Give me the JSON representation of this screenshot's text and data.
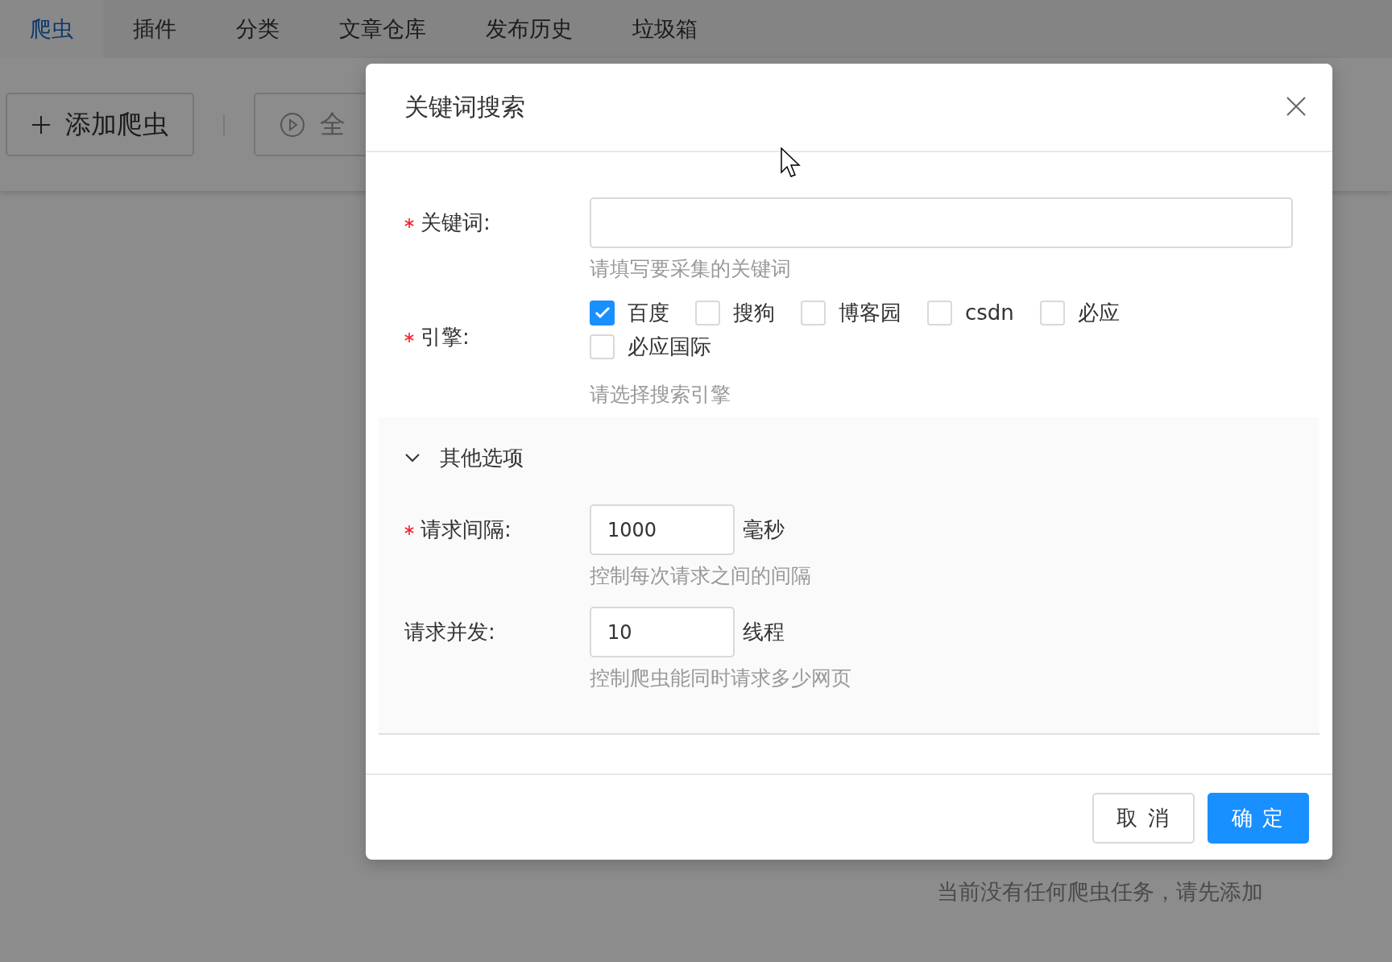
{
  "tabs": [
    {
      "label": "爬虫",
      "selected": true
    },
    {
      "label": "插件",
      "selected": false
    },
    {
      "label": "分类",
      "selected": false
    },
    {
      "label": "文章仓库",
      "selected": false
    },
    {
      "label": "发布历史",
      "selected": false
    },
    {
      "label": "垃圾箱",
      "selected": false
    }
  ],
  "toolbar": {
    "add_button": "添加爬虫",
    "run_button": "全"
  },
  "empty_state": {
    "message": "当前没有任何爬虫任务，请先添加"
  },
  "dialog": {
    "title": "关键词搜索",
    "fields": [
      {
        "kind": "text",
        "label": "关键词:",
        "required": true,
        "hint": "请填写要采集的关键词"
      },
      {
        "kind": "checkboxes",
        "label": "引擎:",
        "required": true,
        "hint": "请选择搜索引擎",
        "options": [
          {
            "label": "百度",
            "checked": true
          },
          {
            "label": "搜狗",
            "checked": false
          },
          {
            "label": "博客园",
            "checked": false
          },
          {
            "label": "csdn",
            "checked": false
          },
          {
            "label": "必应",
            "checked": false
          },
          {
            "label": "必应国际",
            "checked": false
          }
        ]
      }
    ],
    "collapse": {
      "title": "其他选项",
      "expanded": true,
      "fields": [
        {
          "kind": "number",
          "label": "请求间隔:",
          "required": true,
          "value": "1000",
          "unit": "毫秒",
          "hint": "控制每次请求之间的间隔"
        },
        {
          "kind": "number",
          "label": "请求并发:",
          "required": false,
          "value": "10",
          "unit": "线程",
          "hint": "控制爬虫能同时请求多少网页"
        }
      ]
    },
    "buttons": [
      {
        "label": "取 消",
        "kind": "default"
      },
      {
        "label": "确 定",
        "kind": "primary"
      }
    ]
  }
}
